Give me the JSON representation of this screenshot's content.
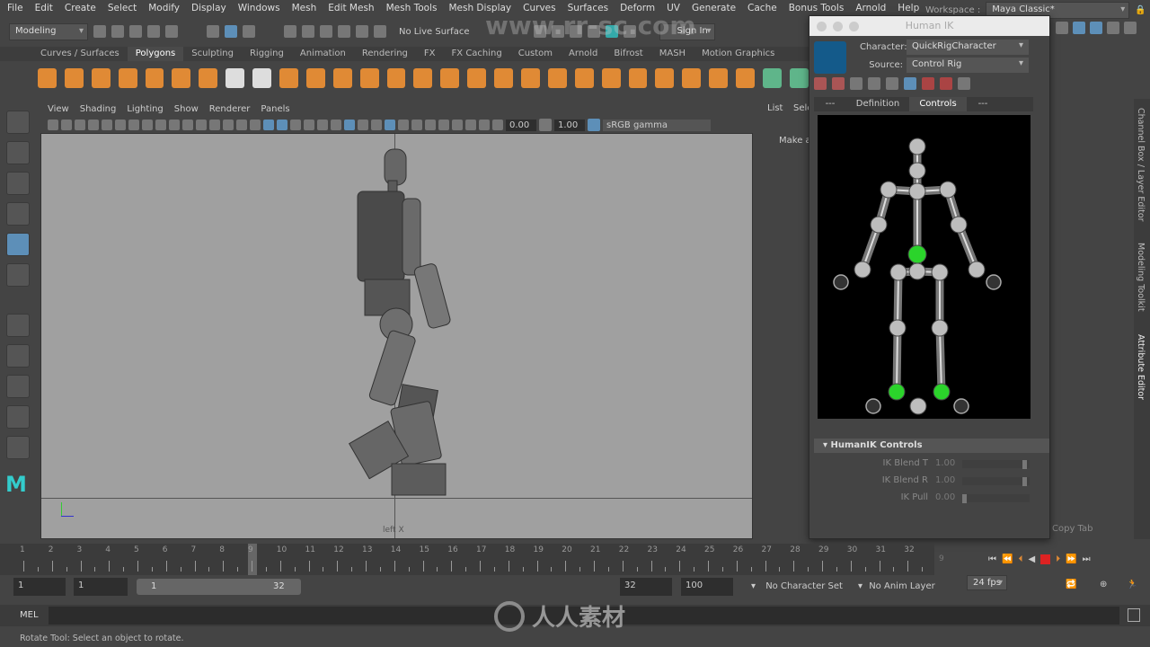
{
  "menu": [
    "File",
    "Edit",
    "Create",
    "Select",
    "Modify",
    "Display",
    "Windows",
    "Mesh",
    "Edit Mesh",
    "Mesh Tools",
    "Mesh Display",
    "Curves",
    "Surfaces",
    "Deform",
    "UV",
    "Generate",
    "Cache",
    "Bonus Tools",
    "Arnold",
    "Help"
  ],
  "workspace": {
    "label": "Workspace :",
    "value": "Maya Classic*"
  },
  "status": {
    "mode": "Modeling",
    "live_surface": "No Live Surface",
    "sign_in": "Sign In"
  },
  "shelf_tabs": [
    "Curves / Surfaces",
    "Polygons",
    "Sculpting",
    "Rigging",
    "Animation",
    "Rendering",
    "FX",
    "FX Caching",
    "Custom",
    "Arnold",
    "Bifrost",
    "MASH",
    "Motion Graphics"
  ],
  "active_shelf": "Polygons",
  "viewport": {
    "menu": [
      "View",
      "Shading",
      "Lighting",
      "Show",
      "Renderer",
      "Panels"
    ],
    "exposure": "0.00",
    "gamma": "1.00",
    "colorspace": "sRGB gamma",
    "camera_label": "left X"
  },
  "right_panel": {
    "tabs": [
      "List",
      "Sele"
    ],
    "text": "Make a",
    "copy_tab": "Copy Tab"
  },
  "side_tabs": [
    "Channel Box / Layer Editor",
    "Modeling Toolkit",
    "Attribute Editor"
  ],
  "human_ik": {
    "title": "Human IK",
    "character_label": "Character:",
    "character": "QuickRigCharacter",
    "source_label": "Source:",
    "source": "Control Rig",
    "tabs": [
      "---",
      "Definition",
      "Controls",
      "---"
    ],
    "active_tab": "Controls",
    "section": "HumanIK Controls",
    "controls": [
      {
        "label": "IK Blend T",
        "value": "1.00",
        "level": 1.0
      },
      {
        "label": "IK Blend R",
        "value": "1.00",
        "level": 1.0
      },
      {
        "label": "IK Pull",
        "value": "0.00",
        "level": 0.0
      }
    ],
    "colors": {
      "selected_effector": "#2bd42b",
      "joint": "#bdbdbd"
    }
  },
  "timeline": {
    "start": 1,
    "end": 32,
    "current": 9,
    "current_label": "9"
  },
  "range": {
    "anim_start": "1",
    "play_start": "1",
    "slider_start": "1",
    "slider_end": "32",
    "play_end": "32",
    "anim_end": "100",
    "character_set": "No Character Set",
    "anim_layer": "No Anim Layer",
    "fps": "24 fps"
  },
  "mel": {
    "label": "MEL"
  },
  "help_line": "Rotate Tool: Select an object to rotate.",
  "watermark": {
    "url": "www.rr-sc.com",
    "text": "人人素材"
  }
}
